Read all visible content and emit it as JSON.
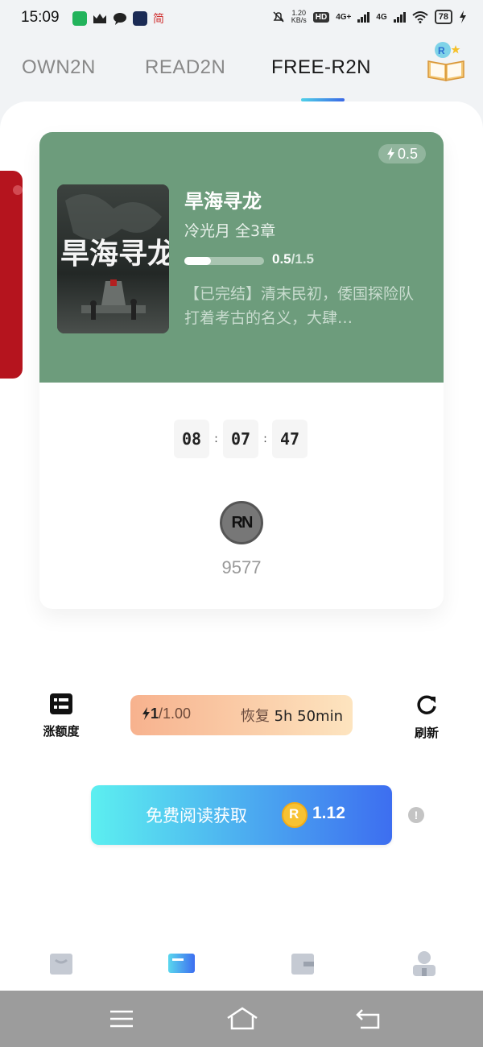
{
  "status_bar": {
    "time": "15:09",
    "lang_indicator": "简",
    "net_speed_value": "1.20",
    "net_speed_unit": "KB/s",
    "hd_badge": "HD",
    "sim1_label": "4G+",
    "sim2_label": "4G",
    "battery": "78"
  },
  "tabs": [
    {
      "label": "OWN2N",
      "active": false
    },
    {
      "label": "READ2N",
      "active": false
    },
    {
      "label": "FREE-R2N",
      "active": true
    }
  ],
  "book_card": {
    "energy_cost": "0.5",
    "cover_text": "旱海寻龙",
    "title": "旱海寻龙",
    "author_chapters": "冷光月 全3章",
    "progress_current": "0.5",
    "progress_total": "/1.5",
    "progress_fraction": 0.333,
    "description": "【已完结】清末民初，倭国探险队打着考古的名义，大肆…",
    "background_color": "#6d9c7c"
  },
  "timer": {
    "hours": "08",
    "minutes": "07",
    "seconds": "47",
    "sep": ":"
  },
  "rn": {
    "logo_text": "RN",
    "count": "9577"
  },
  "actions": {
    "increase_limit_label": "涨额度",
    "refresh_label": "刷新",
    "energy_current": "1",
    "energy_max": "/1.00",
    "recover_label": "恢复",
    "recover_time": "5h 50min"
  },
  "cta": {
    "label": "免费阅读获取",
    "coin_letter": "R",
    "reward": "1.12"
  },
  "info_glyph": "!",
  "bottom_nav": {
    "items": [
      {
        "icon": "bag-icon",
        "active": false
      },
      {
        "icon": "book-open-icon",
        "active": true
      },
      {
        "icon": "wallet-icon",
        "active": false
      },
      {
        "icon": "profile-icon",
        "active": false
      }
    ]
  },
  "colors": {
    "accent_gradient_start": "#5ceff0",
    "accent_gradient_end": "#3d6ef0",
    "side_card": "#b5141e",
    "energy_pill_start": "#f7b28e",
    "energy_pill_end": "#fde4bf"
  }
}
